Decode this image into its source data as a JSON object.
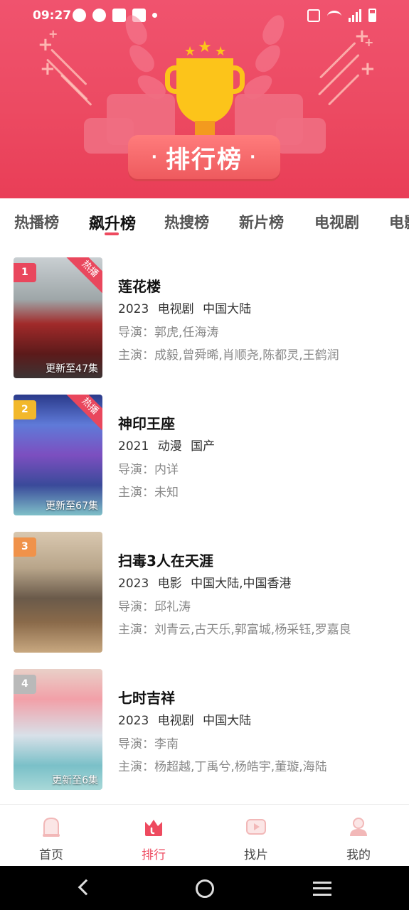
{
  "status_bar": {
    "time": "09:27"
  },
  "banner": {
    "title": "排行榜"
  },
  "tabs": [
    {
      "label": "热播榜",
      "active": false
    },
    {
      "label": "飙升榜",
      "active": true
    },
    {
      "label": "热搜榜",
      "active": false
    },
    {
      "label": "新片榜",
      "active": false
    },
    {
      "label": "电视剧",
      "active": false
    },
    {
      "label": "电影",
      "active": false
    }
  ],
  "list": [
    {
      "rank": "1",
      "rank_color": "#e9475d",
      "hot": "热播",
      "update": "更新至47集",
      "title": "莲花楼",
      "year": "2023",
      "genre": "电视剧",
      "region": "中国大陆",
      "director": "导演：郭虎,任海涛",
      "actors": "主演：成毅,曾舜晞,肖顺尧,陈都灵,王鹤润"
    },
    {
      "rank": "2",
      "rank_color": "#f2b82b",
      "hot": "热播",
      "update": "更新至67集",
      "title": "神印王座",
      "year": "2021",
      "genre": "动漫",
      "region": "国产",
      "director": "导演：内详",
      "actors": "主演：未知"
    },
    {
      "rank": "3",
      "rank_color": "#f0924a",
      "hot": "",
      "update": "",
      "title": "扫毒3人在天涯",
      "year": "2023",
      "genre": "电影",
      "region": "中国大陆,中国香港",
      "director": "导演：邱礼涛",
      "actors": "主演：刘青云,古天乐,郭富城,杨采钰,罗嘉良"
    },
    {
      "rank": "4",
      "rank_color": "#b9b9b9",
      "hot": "",
      "update": "更新至6集",
      "title": "七时吉祥",
      "year": "2023",
      "genre": "电视剧",
      "region": "中国大陆",
      "director": "导演：李南",
      "actors": "主演：杨超越,丁禹兮,杨皓宇,董璇,海陆"
    }
  ],
  "bottom_nav": [
    {
      "label": "首页",
      "icon": "home-icon",
      "active": false
    },
    {
      "label": "排行",
      "icon": "crown-icon",
      "active": true
    },
    {
      "label": "找片",
      "icon": "play-icon",
      "active": false
    },
    {
      "label": "我的",
      "icon": "profile-icon",
      "active": false
    }
  ],
  "colors": {
    "accent": "#ee4a5f",
    "banner": "#ec4a62"
  }
}
